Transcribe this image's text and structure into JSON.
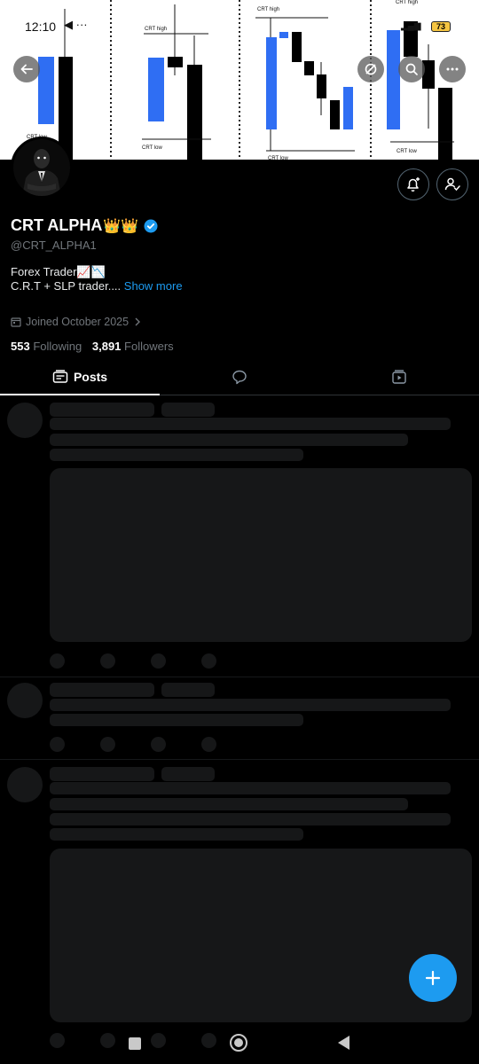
{
  "status": {
    "time": "12:10",
    "battery": "73"
  },
  "banner": {
    "labels": {
      "crt_high": "CRT high",
      "crt_low": "CRT low"
    }
  },
  "profile": {
    "name": "CRT ALPHA",
    "name_emoji": "👑👑",
    "handle": "@CRT_ALPHA1",
    "bio_line1": "Forex Trader📈📉",
    "bio_line2": "C.R.T + SLP trader....",
    "show_more": "Show more",
    "joined": "Joined October 2025",
    "following_count": "553",
    "following_label": "Following",
    "followers_count": "3,891",
    "followers_label": "Followers"
  },
  "tabs": {
    "posts_label": "Posts"
  },
  "icons": {
    "back": "back-arrow-icon",
    "grok": "grok-icon",
    "search": "search-icon",
    "more": "more-icon",
    "notify": "bell-plus-icon",
    "following": "person-check-icon",
    "calendar": "calendar-icon",
    "chevron": "chevron-right-icon",
    "posts": "posts-icon",
    "replies": "chat-bubble-icon",
    "media": "video-icon",
    "compose": "plus-icon"
  },
  "colors": {
    "accent": "#1d9bf0",
    "bull_candle": "#2f6ef3",
    "bear_candle": "#000000"
  }
}
